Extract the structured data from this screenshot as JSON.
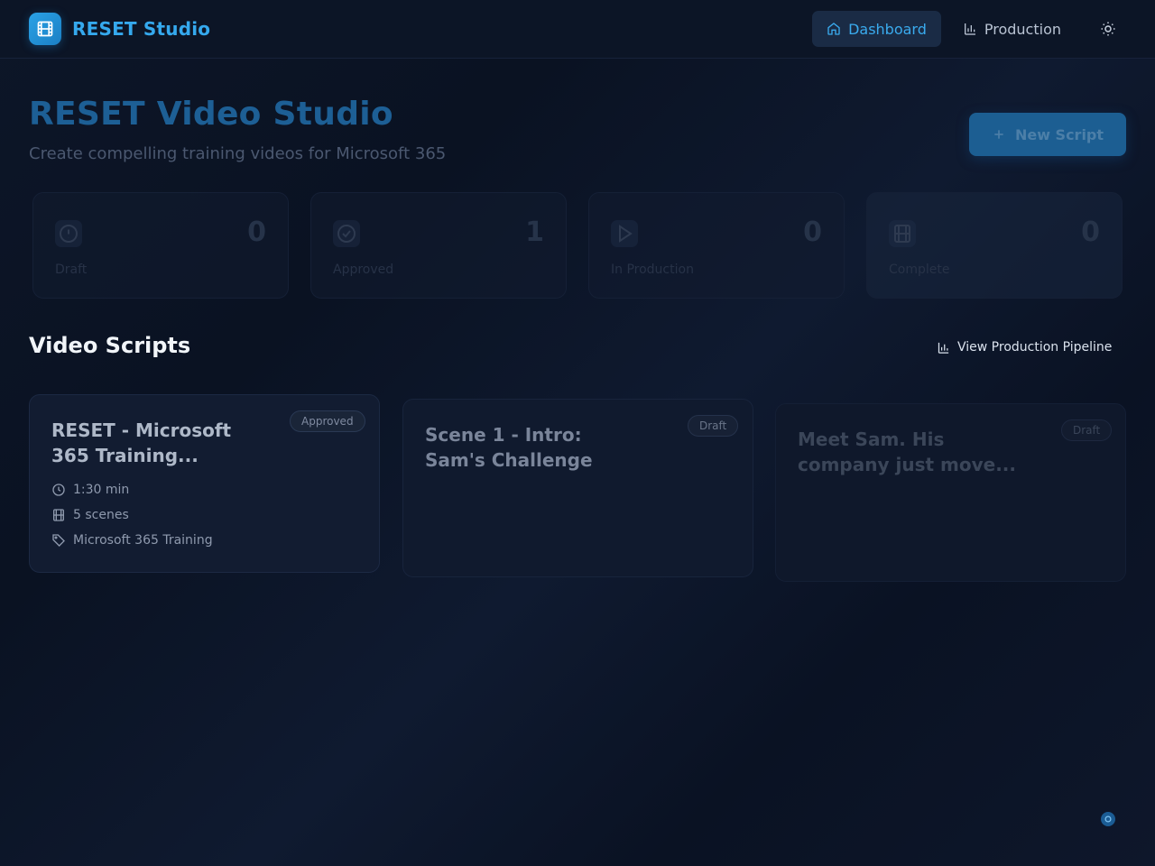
{
  "header": {
    "brand": "RESET Studio",
    "nav": [
      {
        "label": "Dashboard",
        "icon": "home-icon",
        "active": true
      },
      {
        "label": "Production",
        "icon": "bar-chart-icon",
        "active": false
      }
    ],
    "theme_icon": "sun-icon"
  },
  "hero": {
    "title": "RESET Video Studio",
    "subtitle": "Create compelling training videos for Microsoft 365",
    "new_button": "New Script"
  },
  "stats": [
    {
      "label": "Draft",
      "value": "0",
      "icon": "alert-circle-icon"
    },
    {
      "label": "Approved",
      "value": "1",
      "icon": "check-circle-icon"
    },
    {
      "label": "In Production",
      "value": "0",
      "icon": "play-icon"
    },
    {
      "label": "Complete",
      "value": "0",
      "icon": "film-icon"
    }
  ],
  "scripts": {
    "title": "Video Scripts",
    "pipeline_link": "View Production Pipeline",
    "cards": [
      {
        "title_line1": "RESET - Microsoft",
        "title_line2": "365 Training...",
        "status": "Approved",
        "duration": "1:30 min",
        "scenes": "5 scenes",
        "tag": "Microsoft 365 Training"
      },
      {
        "title_line1": "Scene 1 - Intro:",
        "title_line2": "Sam's Challenge",
        "status": "Draft"
      },
      {
        "title_line1": "Meet Sam. His",
        "title_line2": "company just move...",
        "status": "Draft"
      }
    ]
  },
  "colors": {
    "accent": "#35a9ee",
    "background": "#0b1324",
    "card": "#111b2f"
  }
}
